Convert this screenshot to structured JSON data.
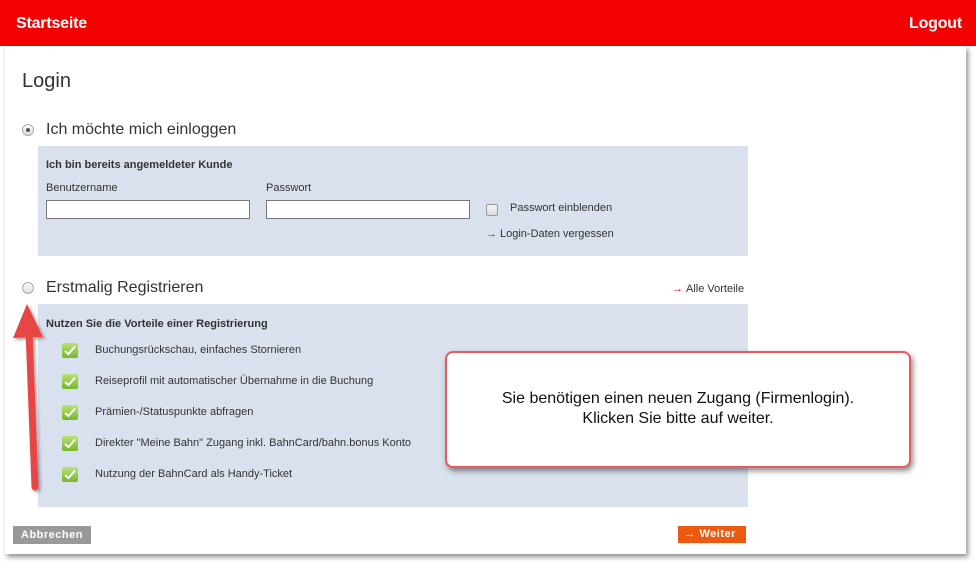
{
  "header": {
    "home_label": "Startseite",
    "logout_label": "Logout",
    "color": "#f30000"
  },
  "page": {
    "title": "Login"
  },
  "login_option": {
    "label": "Ich möchte mich einloggen",
    "selected": true,
    "box_title": "Ich bin bereits angemeldeter Kunde",
    "username_label": "Benutzername",
    "username_value": "",
    "password_label": "Passwort",
    "password_value": "",
    "show_password_label": "Passwort einblenden",
    "show_password_checked": false,
    "forgot_link": "Login-Daten vergessen"
  },
  "register_option": {
    "label": "Erstmalig Registrieren",
    "selected": false,
    "all_benefits_link": "Alle Vorteile",
    "box_title": "Nutzen Sie die Vorteile einer Registrierung",
    "benefits": [
      "Buchungsrückschau, einfaches Stornieren",
      "Reiseprofil mit automatischer Übernahme in die Buchung",
      "Prämien-/Statuspunkte abfragen",
      "Direkter \"Meine Bahn\" Zugang inkl. BahnCard/bahn.bonus Konto",
      "Nutzung der BahnCard als Handy-Ticket"
    ]
  },
  "buttons": {
    "cancel_label": "Abbrechen",
    "next_label": "Weiter",
    "next_color": "#ec5a11"
  },
  "callout": {
    "line1": "Sie benötigen einen neuen Zugang (Firmenlogin).",
    "line2": "Klicken Sie bitte auf weiter."
  },
  "icons": {
    "check": "check-icon",
    "arrow": "arrow-right-icon",
    "annotation": "annotation-arrow-up"
  },
  "colors": {
    "box_background": "#d9e1ee",
    "link_arrow": "#e2001a",
    "annotation": "#e84545"
  }
}
